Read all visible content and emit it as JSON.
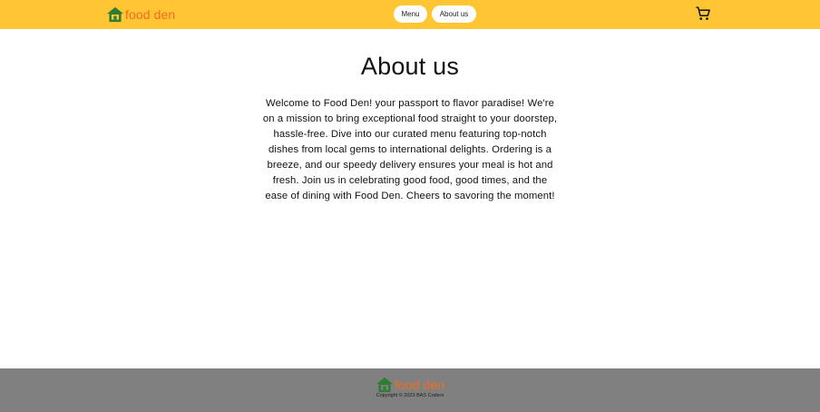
{
  "header": {
    "brand_icon": "home-icon",
    "brand_name": "food den",
    "nav": {
      "menu_label": "Menu",
      "about_label": "About us"
    },
    "cart_icon": "shopping-cart-icon"
  },
  "main": {
    "title": "About us",
    "body": "Welcome to Food Den! your passport to flavor paradise! We're on a mission to bring exceptional food straight to your doorstep, hassle-free. Dive into our curated menu featuring top-notch dishes from local gems to international delights. Ordering is a breeze, and our speedy delivery ensures your meal is hot and fresh. Join us in celebrating good food, good times, and the ease of dining with Food Den. Cheers to savoring the moment!"
  },
  "footer": {
    "brand_icon": "home-icon",
    "brand_name": "food den",
    "copyright": "Copyright © 2023 BAS Coders"
  },
  "colors": {
    "header_bg": "#ffc532",
    "brand_text": "#f26b21",
    "brand_icon": "#2e7d32",
    "footer_bg": "#808080"
  }
}
